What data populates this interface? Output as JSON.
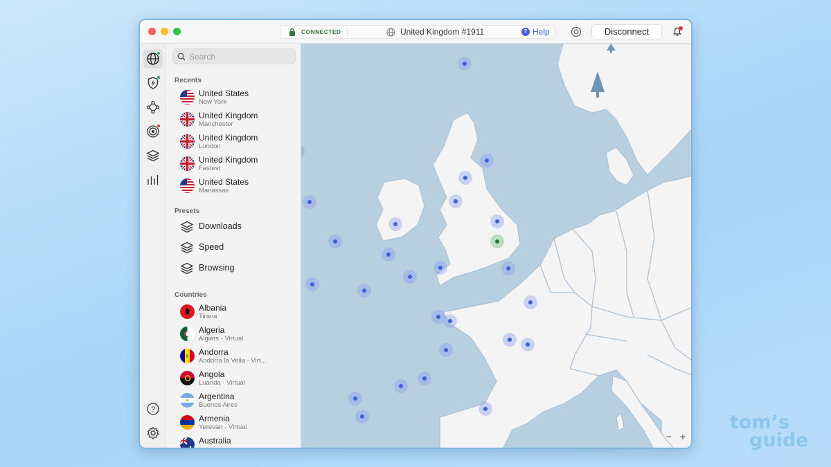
{
  "titlebar": {
    "status": "CONNECTED",
    "server": "United Kingdom #1911",
    "help": "Help",
    "disconnect": "Disconnect"
  },
  "search": {
    "placeholder": "Search",
    "value": ""
  },
  "recents": {
    "title": "Recents",
    "items": [
      {
        "name": "United States",
        "sub": "New York",
        "flag": "us"
      },
      {
        "name": "United Kingdom",
        "sub": "Manchester",
        "flag": "uk"
      },
      {
        "name": "United Kingdom",
        "sub": "London",
        "flag": "uk"
      },
      {
        "name": "United Kingdom",
        "sub": "Fastest",
        "flag": "uk"
      },
      {
        "name": "United States",
        "sub": "Manassas",
        "flag": "us"
      }
    ]
  },
  "presets": {
    "title": "Presets",
    "items": [
      {
        "label": "Downloads"
      },
      {
        "label": "Speed"
      },
      {
        "label": "Browsing"
      }
    ]
  },
  "countries": {
    "title": "Countries",
    "items": [
      {
        "name": "Albania",
        "sub": "Tirana",
        "flag": "al"
      },
      {
        "name": "Algeria",
        "sub": "Algiers - Virtual",
        "flag": "dz"
      },
      {
        "name": "Andorra",
        "sub": "Andorra la Vella - Virt...",
        "flag": "ad"
      },
      {
        "name": "Angola",
        "sub": "Luanda - Virtual",
        "flag": "ao"
      },
      {
        "name": "Argentina",
        "sub": "Buenos Aires",
        "flag": "ar"
      },
      {
        "name": "Armenia",
        "sub": "Yerevan - Virtual",
        "flag": "am"
      },
      {
        "name": "Australia",
        "sub": "",
        "flag": "au"
      }
    ]
  },
  "rail": {
    "icons": [
      "globe-icon",
      "shield-bolt-icon",
      "meshnet-icon",
      "target-icon",
      "layers-icon",
      "stats-icon",
      "help-icon",
      "settings-icon"
    ]
  },
  "map": {
    "zoom_out": "−",
    "zoom_in": "+"
  },
  "watermark": {
    "line1": "tom’s",
    "line2": "guide"
  },
  "colors": {
    "accent": "#3d63e0",
    "connected": "#2f7a3e",
    "sea": "#b8cfdf",
    "land": "#f4f4f4"
  }
}
